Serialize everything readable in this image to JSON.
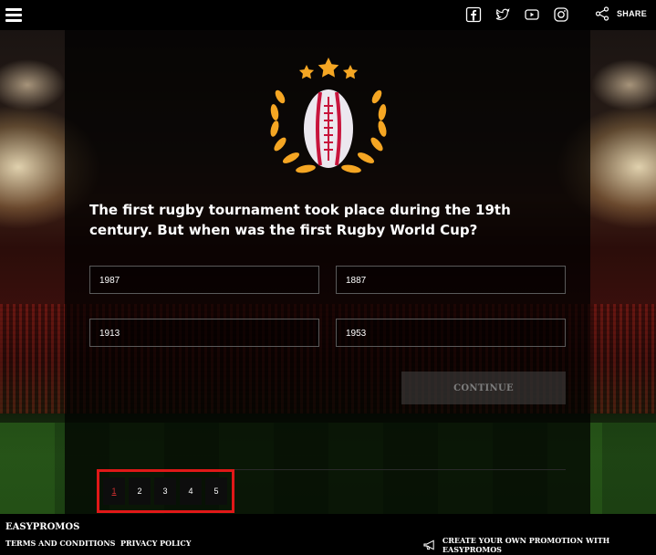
{
  "header": {
    "icons": [
      "menu-icon",
      "facebook-icon",
      "twitter-icon",
      "youtube-icon",
      "instagram-icon",
      "share-icon"
    ],
    "share_label": "SHARE"
  },
  "quiz": {
    "question": "The first rugby tournament took place during the 19th century. But when was the first Rugby World Cup?",
    "answers": [
      "1987",
      "1887",
      "1913",
      "1953"
    ],
    "continue_label": "CONTINUE"
  },
  "pagination": {
    "pages": [
      "1",
      "2",
      "3",
      "4",
      "5"
    ],
    "current": "1"
  },
  "footer": {
    "brand": "EASYPROMOS",
    "terms": "TERMS AND CONDITIONS",
    "privacy": "PRIVACY POLICY",
    "promo": "CREATE YOUR OWN PROMOTION WITH EASYPROMOS"
  },
  "colors": {
    "highlight_border": "#e01818",
    "logo_gold": "#f5a623",
    "ball_stripe": "#c8143c"
  }
}
